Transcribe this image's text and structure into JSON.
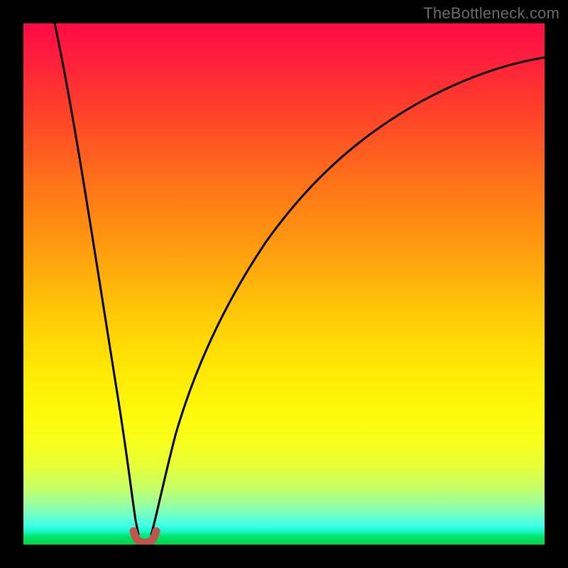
{
  "watermark": "TheBottleneck.com",
  "colors": {
    "frame": "#000000",
    "curve": "#000000",
    "marker_fill": "#c1554d",
    "marker_stroke": "#b24b44",
    "gradient_stops": [
      "#ff0b45",
      "#ff7e16",
      "#ffe705",
      "#00d63c"
    ]
  },
  "chart_data": {
    "type": "line",
    "title": "",
    "xlabel": "",
    "ylabel": "",
    "xlim": [
      0,
      100
    ],
    "ylim": [
      0,
      100
    ],
    "grid": false,
    "legend": false,
    "series": [
      {
        "name": "left-branch",
        "x": [
          6,
          8,
          10,
          12,
          14,
          16,
          18,
          19.5,
          20.5,
          21,
          21.5
        ],
        "y": [
          100,
          86,
          72,
          58,
          45,
          32,
          19,
          10,
          5,
          2.2,
          1
        ]
      },
      {
        "name": "right-branch",
        "x": [
          24.5,
          25,
          26,
          28,
          31,
          35,
          40,
          46,
          53,
          61,
          70,
          80,
          90,
          100
        ],
        "y": [
          1,
          2.2,
          6,
          14,
          24,
          35,
          46,
          55,
          63,
          70,
          76,
          81,
          85,
          88
        ]
      },
      {
        "name": "minimum-marker",
        "x": [
          21,
          21.6,
          22.3,
          23,
          23.7,
          24.4,
          25
        ],
        "y": [
          2.2,
          1.2,
          0.7,
          0.6,
          0.7,
          1.2,
          2.2
        ]
      }
    ],
    "annotations": []
  }
}
